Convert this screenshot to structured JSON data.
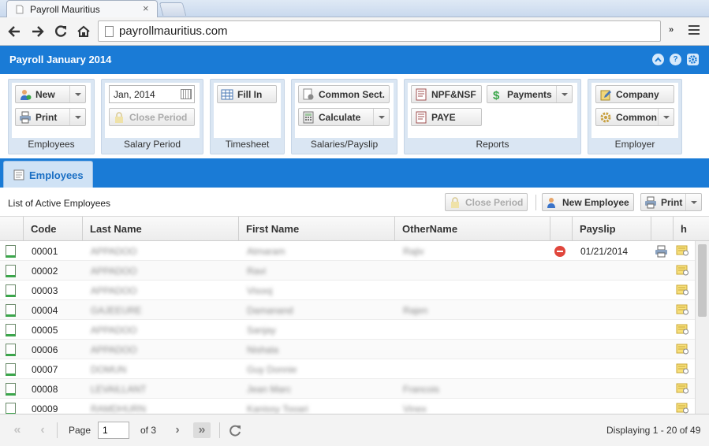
{
  "browser": {
    "tab_title": "Payroll Mauritius",
    "tab_close": "×",
    "url": "payrollmauritius.com",
    "extensions_label": "»"
  },
  "app": {
    "title": "Payroll January 2014",
    "header_icons": [
      "collapse-icon",
      "help-icon",
      "settings-icon"
    ],
    "accent_color": "#1a7bd6"
  },
  "ribbon": {
    "employees": {
      "label": "Employees",
      "new_label": "New",
      "print_label": "Print"
    },
    "salary_period": {
      "label": "Salary Period",
      "period_value": "Jan, 2014",
      "close_period_label": "Close Period"
    },
    "timesheet": {
      "label": "Timesheet",
      "fill_in_label": "Fill In"
    },
    "salaries": {
      "label": "Salaries/Payslip",
      "common_sect_label": "Common Sect.",
      "calculate_label": "Calculate"
    },
    "reports": {
      "label": "Reports",
      "npf_label": "NPF&NSF",
      "payments_label": "Payments",
      "paye_label": "PAYE"
    },
    "employer": {
      "label": "Employer",
      "company_label": "Company",
      "common_label": "Common"
    }
  },
  "panel": {
    "tab_label": "Employees",
    "grid_title": "List of Active Employees",
    "close_period_label": "Close Period",
    "new_employee_label": "New Employee",
    "print_label": "Print"
  },
  "grid": {
    "columns": [
      "Code",
      "Last Name",
      "First Name",
      "OtherName",
      "Payslip",
      "h"
    ],
    "rows": [
      {
        "code": "00001",
        "last": "APPADOO",
        "first": "Atmaram",
        "other": "Rajiv",
        "payslip": "01/21/2014",
        "has_delete": true,
        "has_print": true
      },
      {
        "code": "00002",
        "last": "APPADOO",
        "first": "Ravi",
        "other": "",
        "payslip": "",
        "has_delete": false,
        "has_print": false
      },
      {
        "code": "00003",
        "last": "APPADOO",
        "first": "Visooj",
        "other": "",
        "payslip": "",
        "has_delete": false,
        "has_print": false
      },
      {
        "code": "00004",
        "last": "GAJEEURE",
        "first": "Damanand",
        "other": "Rajen",
        "payslip": "",
        "has_delete": false,
        "has_print": false
      },
      {
        "code": "00005",
        "last": "APPADOO",
        "first": "Sanjay",
        "other": "",
        "payslip": "",
        "has_delete": false,
        "has_print": false
      },
      {
        "code": "00006",
        "last": "APPADOO",
        "first": "Nishala",
        "other": "",
        "payslip": "",
        "has_delete": false,
        "has_print": false
      },
      {
        "code": "00007",
        "last": "DOMUN",
        "first": "Guy Donnie",
        "other": "",
        "payslip": "",
        "has_delete": false,
        "has_print": false
      },
      {
        "code": "00008",
        "last": "LEVAILLANT",
        "first": "Jean Marc",
        "other": "Francois",
        "payslip": "",
        "has_delete": false,
        "has_print": false
      },
      {
        "code": "00009",
        "last": "RAMDHURN",
        "first": "Kanissy Tooari",
        "other": "Vinex",
        "payslip": "",
        "has_delete": false,
        "has_print": false
      }
    ]
  },
  "pager": {
    "page_label": "Page",
    "page_value": "1",
    "of_label": "of 3",
    "displaying": "Displaying 1 - 20 of 49"
  }
}
